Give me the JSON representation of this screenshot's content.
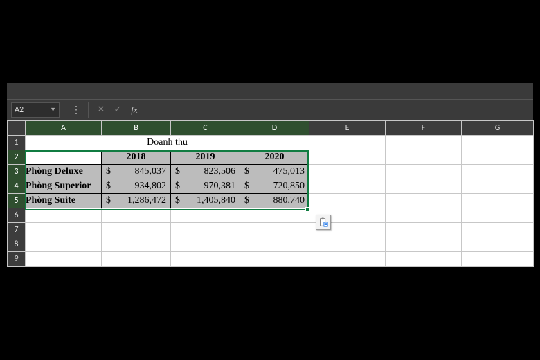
{
  "formula_bar": {
    "name_box": "A2",
    "cancel_glyph": "✕",
    "enter_glyph": "✓",
    "fx_label": "fx",
    "input_value": ""
  },
  "columns": [
    "A",
    "B",
    "C",
    "D",
    "E",
    "F",
    "G"
  ],
  "rows": [
    "1",
    "2",
    "3",
    "4",
    "5",
    "6",
    "7",
    "8",
    "9"
  ],
  "selected_range": "A2:D5",
  "active_cell": "A2",
  "table": {
    "title": "Doanh thu",
    "currency_symbol": "$",
    "year_headers": [
      "2018",
      "2019",
      "2020"
    ],
    "rows": [
      {
        "label": "Phòng Deluxe",
        "values": [
          "845,037",
          "823,506",
          "475,013"
        ]
      },
      {
        "label": "Phòng Superior",
        "values": [
          "934,802",
          "970,381",
          "720,850"
        ]
      },
      {
        "label": "Phòng Suite",
        "values": [
          "1,286,472",
          "1,405,840",
          "880,740"
        ]
      }
    ]
  },
  "paste_options_tooltip": "Paste Options"
}
